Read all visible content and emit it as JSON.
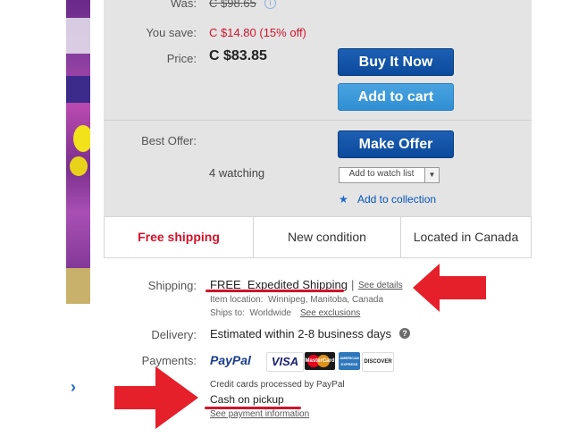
{
  "pricing": {
    "was_label": "Was:",
    "was_value": "C $98.65",
    "save_label": "You save:",
    "save_value": "C $14.80 (15% off)",
    "price_label": "Price:",
    "price_value": "C $83.85"
  },
  "buttons": {
    "buy_now": "Buy It Now",
    "add_cart": "Add to cart",
    "make_offer": "Make Offer"
  },
  "offer": {
    "label": "Best Offer:",
    "watching": "4 watching",
    "watch_list": "Add to watch list",
    "collection": "Add to collection"
  },
  "infobar": {
    "shipping": "Free shipping",
    "condition": "New condition",
    "location": "Located in Canada"
  },
  "shipping": {
    "label": "Shipping:",
    "value": "FREE  Expedited Shipping",
    "sep": "|",
    "see_details": "See details",
    "item_location": "Item location:  Winnipeg, Manitoba, Canada",
    "ships_to": "Ships to:  Worldwide",
    "see_exclusions": "See exclusions"
  },
  "delivery": {
    "label": "Delivery:",
    "value": "Estimated within 2-8 business days",
    "help": "?"
  },
  "payments": {
    "label": "Payments:",
    "paypal": "PayPal",
    "visa": "VISA",
    "mastercard": "MasterCard",
    "amex": "AMERICAN EXPRESS",
    "discover": "DISCOVER",
    "credit_note": "Credit cards processed by PayPal",
    "cash": "Cash on pickup",
    "see_payment": "See payment information"
  },
  "colors": {
    "red": "#d0142c",
    "blue_dark": "#0b4a9c",
    "blue_light": "#2f8fd3",
    "link": "#0654ba"
  }
}
